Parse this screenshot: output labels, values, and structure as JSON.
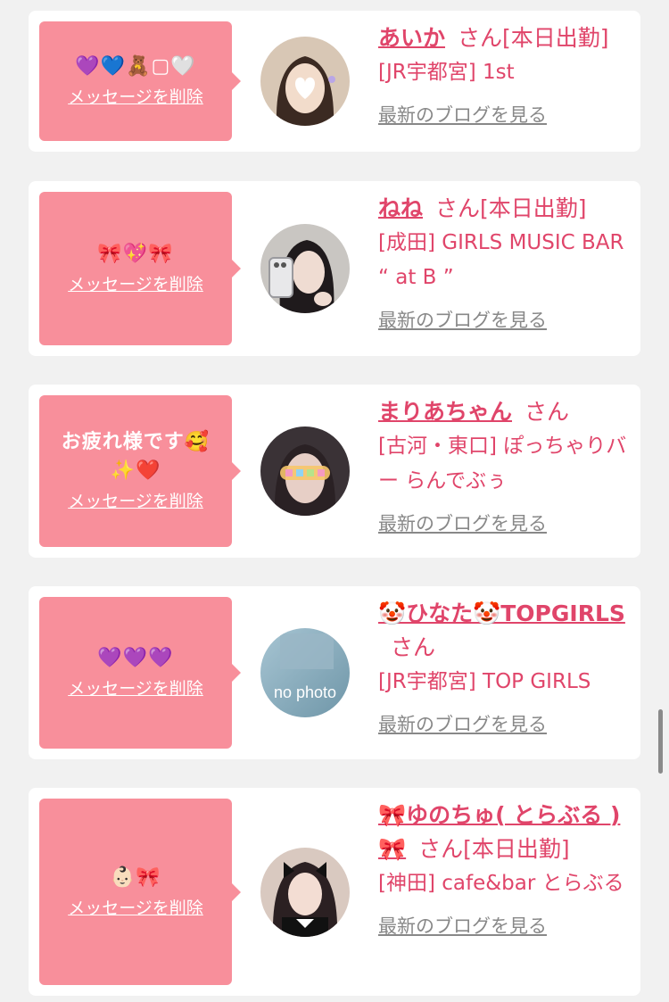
{
  "cards": [
    {
      "message_emoji": "💜💙🧸▢🤍",
      "message_text": "",
      "delete_label": "メッセージを削除",
      "name": "あいか",
      "san": "さん",
      "status": "[本日出勤]",
      "shop": "[JR宇都宮] 1st",
      "blog_label": "最新のブログを見る"
    },
    {
      "message_emoji": "🎀💖🎀",
      "message_text": "",
      "delete_label": "メッセージを削除",
      "name": "ねね",
      "san": "さん",
      "status": "[本日出勤]",
      "shop": "[成田] GIRLS MUSIC BAR “ at B ”",
      "blog_label": "最新のブログを見る"
    },
    {
      "message_emoji": "🥰 ✨❤️",
      "message_text": "お疲れ様です",
      "delete_label": "メッセージを削除",
      "name": "まりあちゃん",
      "san": "さん",
      "status": "",
      "shop": "[古河・東口] ぽっちゃりバー らんでぶぅ",
      "blog_label": "最新のブログを見る"
    },
    {
      "message_emoji": "💜💜💜",
      "message_text": "",
      "delete_label": "メッセージを削除",
      "name": "🤡ひなた🤡TOPGIRLS",
      "san": "さん",
      "status": "",
      "shop": "[JR宇都宮] TOP GIRLS",
      "avatar_text": "no photo",
      "blog_label": "最新のブログを見る"
    },
    {
      "message_emoji": "👶🏻🎀",
      "message_text": "",
      "delete_label": "メッセージを削除",
      "name": "🎀ゆのちゅ( とらぶる )🎀",
      "san": "さん",
      "status": "[本日出勤]",
      "shop": "[神田] cafe&bar とらぶる",
      "blog_label": "最新のブログを見る"
    }
  ],
  "colors": {
    "accent": "#e0456a",
    "message_bg": "#f88f9b",
    "page_bg": "#f1f1f1",
    "link_gray": "#888888"
  }
}
